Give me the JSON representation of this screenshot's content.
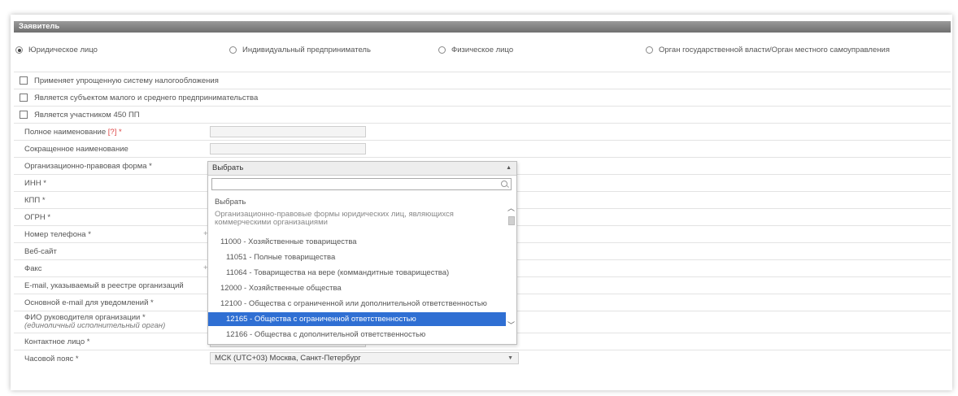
{
  "panel": {
    "title": "Заявитель",
    "applicant_types": [
      {
        "label": "Юридическое лицо",
        "checked": true
      },
      {
        "label": "Индивидуальный предприниматель",
        "checked": false
      },
      {
        "label": "Физическое лицо",
        "checked": false
      },
      {
        "label": "Орган государственной власти/Орган местного самоуправления",
        "checked": false
      }
    ],
    "checkboxes": [
      "Применяет упрощенную систему налогообложения",
      "Является субъектом малого и среднего предпринимательства",
      "Является участником 450 ПП"
    ],
    "fields": {
      "full_name": "Полное наименование",
      "full_name_help": "[?]",
      "required_mark": "*",
      "short_name": "Сокращенное наименование",
      "org_form": "Организационно-правовая форма *",
      "inn": "ИНН *",
      "kpp": "КПП *",
      "ogrn": "ОГРН *",
      "phone": "Номер телефона *",
      "website": "Веб-сайт",
      "fax": "Факс",
      "email_registry": "E-mail, указываемый в реестре организаций",
      "email_notify": "Основной e-mail для уведомлений *",
      "director": "ФИО руководителя организации *",
      "director_sub": "(единоличный исполнительный орган)",
      "contact": "Контактное лицо *",
      "timezone": "Часовой пояс *",
      "plus": "+"
    },
    "org_form_select": {
      "value": "Выбрать",
      "options": [
        {
          "label": "Выбрать",
          "type": "item",
          "indent": 0
        },
        {
          "label": "Организационно-правовые формы юридических лиц, являющихся коммерческими организациями",
          "type": "group",
          "indent": 0
        },
        {
          "label": "11000 - Хозяйственные товарищества",
          "type": "item",
          "indent": 1
        },
        {
          "label": "11051 - Полные товарищества",
          "type": "item",
          "indent": 2
        },
        {
          "label": "11064 - Товарищества на вере (коммандитные товарищества)",
          "type": "item",
          "indent": 2
        },
        {
          "label": "12000 - Хозяйственные общества",
          "type": "item",
          "indent": 1
        },
        {
          "label": "12100 - Общества с ограниченной или дополнительной ответственностью",
          "type": "item",
          "indent": 1
        },
        {
          "label": "12165 - Общества с ограниченной ответственностью",
          "type": "item",
          "indent": 2,
          "selected": true
        },
        {
          "label": "12166 - Общества с дополнительной ответственностью",
          "type": "item",
          "indent": 2
        }
      ]
    },
    "timezone_select": {
      "value": "МСК (UTC+03) Москва, Санкт-Петербург"
    }
  },
  "colors": {
    "header": "#7f7f7f",
    "selected": "#2f6fd3"
  }
}
